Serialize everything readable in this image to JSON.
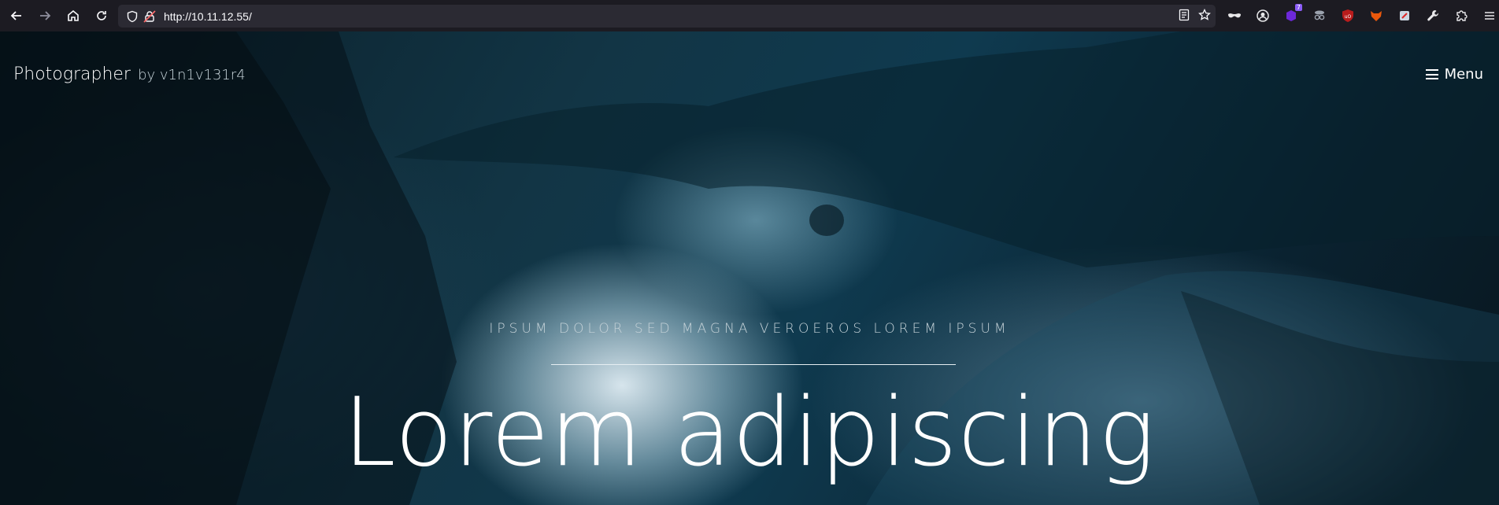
{
  "browser": {
    "url": "http://10.11.12.55/",
    "toolbar_icons": [
      "back-icon",
      "forward-icon",
      "home-icon",
      "reload-icon"
    ],
    "urlbar_left_icons": [
      "tracking-shield-icon",
      "insecure-lock-icon"
    ],
    "urlbar_right_icons": [
      "reader-view-icon",
      "bookmark-star-icon"
    ],
    "extensions": [
      {
        "name": "mask-extension-icon",
        "color": "#e8e8ea"
      },
      {
        "name": "account-icon",
        "color": "#e8e8ea"
      },
      {
        "name": "cube-extension-icon",
        "color": "#6d28d9",
        "badge": "7"
      },
      {
        "name": "spy-extension-icon",
        "color": "#9ca3af"
      },
      {
        "name": "ublock-icon",
        "color": "#b91c1c"
      },
      {
        "name": "fox-extension-icon",
        "color": "#ea580c"
      },
      {
        "name": "picker-extension-icon",
        "color": "#cbd5e1"
      },
      {
        "name": "wrench-icon",
        "color": "#e8e8ea"
      },
      {
        "name": "extensions-puzzle-icon",
        "color": "#e8e8ea"
      },
      {
        "name": "hamburger-menu-icon",
        "color": "#e8e8ea"
      }
    ]
  },
  "site": {
    "brand_name": "Photographer",
    "brand_by": "by v1n1v131r4",
    "menu_label": "Menu",
    "menu_icon": "bars-icon",
    "tagline": "IPSUM DOLOR SED MAGNA VEROEROS LOREM IPSUM",
    "headline": "Lorem adipiscing"
  }
}
